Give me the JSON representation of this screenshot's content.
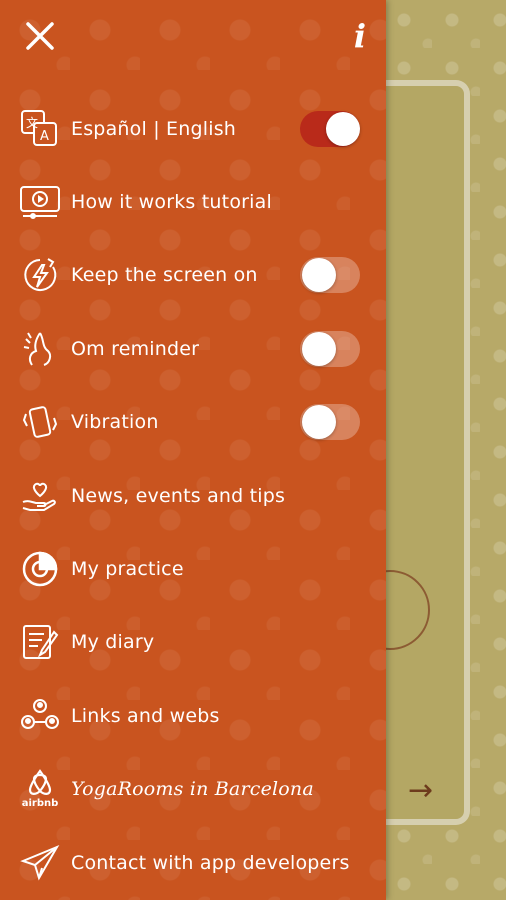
{
  "header": {
    "close_icon": "close-icon",
    "info_label": "i"
  },
  "menu": {
    "items": [
      {
        "label": "Español | English",
        "icon": "translate-icon",
        "toggle": true,
        "on": true
      },
      {
        "label": "How it works tutorial",
        "icon": "video-tutorial-icon"
      },
      {
        "label": "Keep the screen on",
        "icon": "screen-on-icon",
        "toggle": true,
        "on": false
      },
      {
        "label": "Om reminder",
        "icon": "om-reminder-icon",
        "toggle": true,
        "on": false
      },
      {
        "label": "Vibration",
        "icon": "vibration-icon",
        "toggle": true,
        "on": false
      },
      {
        "label": "News, events and tips",
        "icon": "heart-hand-icon"
      },
      {
        "label": "My practice",
        "icon": "practice-chart-icon"
      },
      {
        "label": "My diary",
        "icon": "diary-icon"
      },
      {
        "label": "Links and webs",
        "icon": "links-icon"
      },
      {
        "label": "YogaRooms in Barcelona",
        "icon": "airbnb-icon",
        "icon_text": "airbnb"
      },
      {
        "label": "Contact with app developers",
        "icon": "paper-plane-icon"
      }
    ]
  },
  "background": {
    "next_arrow": "→"
  },
  "colors": {
    "drawer": "#c9541f",
    "toggle_on": "#b92a1a",
    "background": "#b7a968"
  }
}
